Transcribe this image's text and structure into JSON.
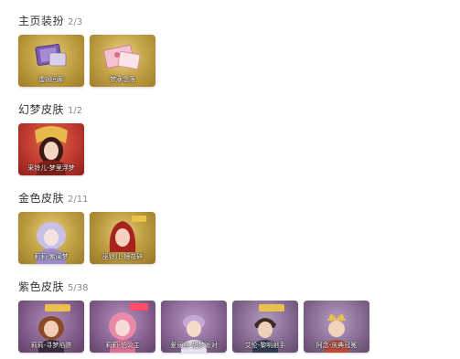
{
  "sections": [
    {
      "name": "主页装扮",
      "count": "2/3",
      "items": [
        {
          "label": "虚钢回廊",
          "theme": "gold",
          "icon": "purple-frame-icon"
        },
        {
          "label": "梦寐念落",
          "theme": "gold",
          "icon": "pink-frame-icon"
        }
      ]
    },
    {
      "name": "幻梦皮肤",
      "count": "1/2",
      "items": [
        {
          "label": "采铃儿-梦里浮梦",
          "theme": "red",
          "icon": "character-portrait-icon"
        }
      ]
    },
    {
      "name": "金色皮肤",
      "count": "2/11",
      "items": [
        {
          "label": "莉莉-紫闺梦",
          "theme": "gold",
          "icon": "character-portrait-icon"
        },
        {
          "label": "巫铃儿-镜花碎",
          "theme": "gold",
          "icon": "character-portrait-icon"
        }
      ]
    },
    {
      "name": "紫色皮肤",
      "count": "5/38",
      "items": [
        {
          "label": "莉莉-寻梦陷阱",
          "theme": "purple",
          "icon": "character-portrait-icon"
        },
        {
          "label": "莉莉-怕公主",
          "theme": "purple",
          "icon": "character-portrait-icon"
        },
        {
          "label": "爱丽丝-甜梦派对",
          "theme": "purple",
          "icon": "character-portrait-icon"
        },
        {
          "label": "艾伦-黎明射手",
          "theme": "purple",
          "icon": "character-portrait-icon"
        },
        {
          "label": "阿念-庆典冠冕",
          "theme": "purple",
          "icon": "character-portrait-icon"
        }
      ]
    }
  ],
  "colors": {
    "gold": "#b99436",
    "red": "#b9322b",
    "purple": "#7e5a86",
    "title": "#333333",
    "count": "#8a8a8a"
  }
}
